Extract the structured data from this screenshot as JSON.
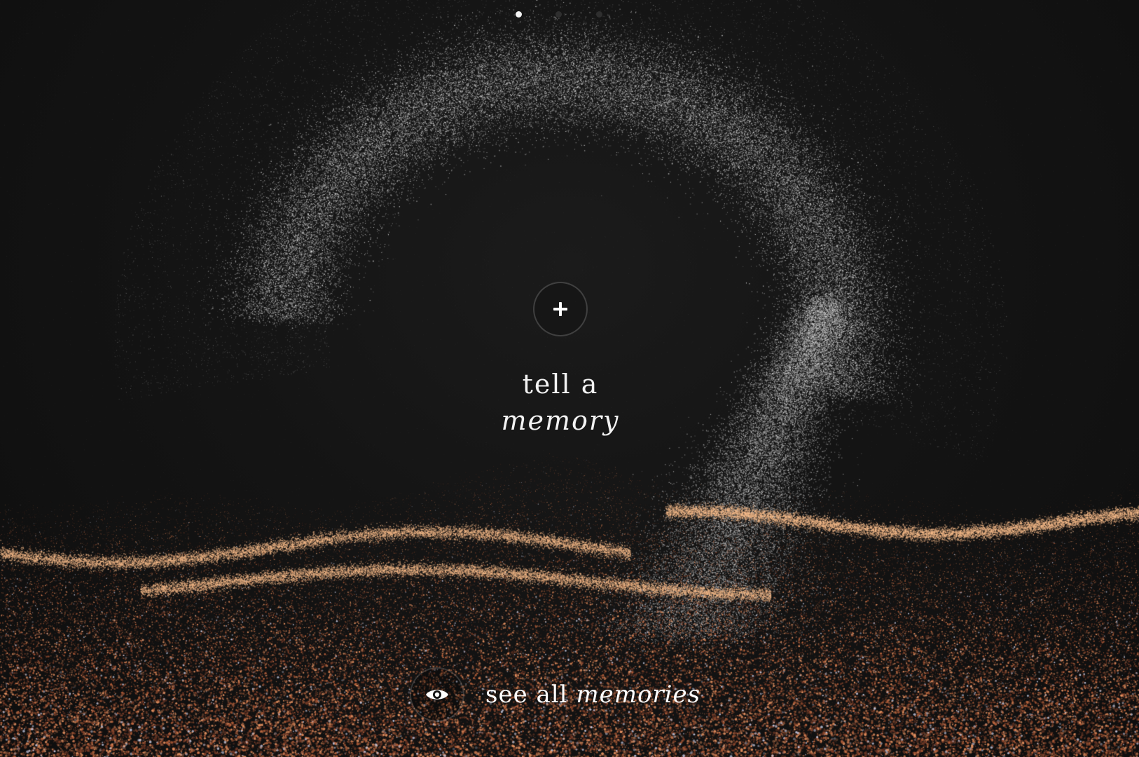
{
  "pager": {
    "count": 3,
    "active_index": 0
  },
  "hero": {
    "add_icon": "plus-icon",
    "title_line1": "tell a",
    "title_line2": "memory"
  },
  "footer": {
    "view_icon": "eye-icon",
    "see_all_plain": "see all",
    "see_all_emphasis": "memories"
  },
  "colors": {
    "background": "#121212",
    "particle_light": "#d8d8d8",
    "particle_warm": "#e0885a",
    "text": "#f3f3f3"
  }
}
